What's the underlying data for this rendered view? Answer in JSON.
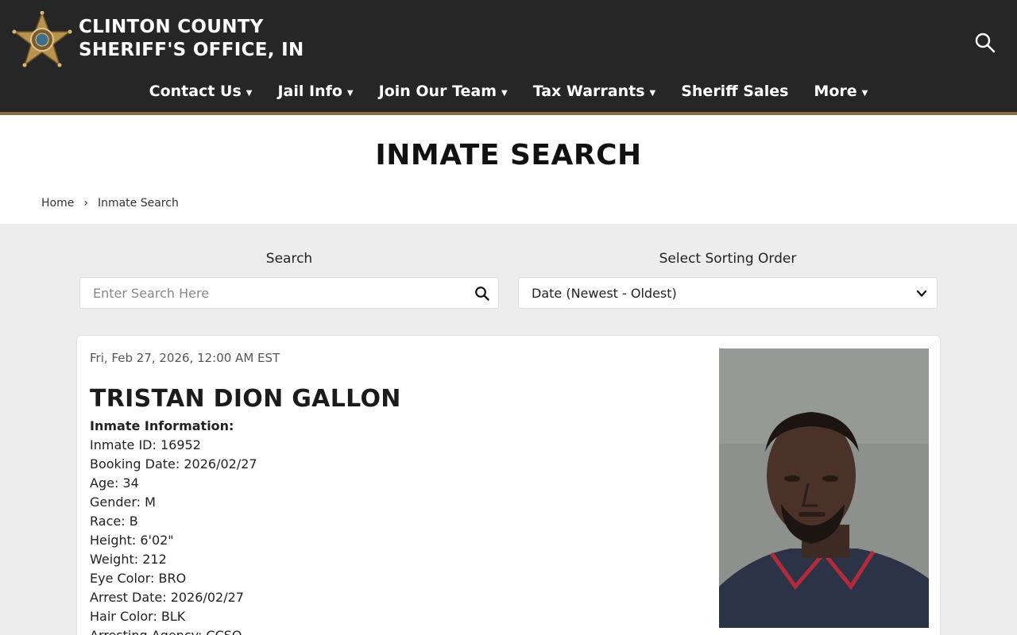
{
  "site": {
    "name_line1": "CLINTON COUNTY",
    "name_line2": "SHERIFF'S OFFICE, IN",
    "logo_icon": "sheriff-star-badge-icon",
    "header_color": "#262626",
    "accent_color": "#8a6a3e"
  },
  "nav": {
    "items": [
      {
        "label": "Contact Us",
        "has_dropdown": true
      },
      {
        "label": "Jail Info",
        "has_dropdown": true
      },
      {
        "label": "Join Our Team",
        "has_dropdown": true
      },
      {
        "label": "Tax Warrants",
        "has_dropdown": true
      },
      {
        "label": "Sheriff Sales",
        "has_dropdown": false
      },
      {
        "label": "More",
        "has_dropdown": true
      }
    ]
  },
  "page": {
    "title": "INMATE SEARCH"
  },
  "breadcrumb": {
    "home": "Home",
    "separator": "›",
    "current": "Inmate Search"
  },
  "search": {
    "label": "Search",
    "placeholder": "Enter Search Here",
    "value": ""
  },
  "sort": {
    "label": "Select Sorting Order",
    "selected": "Date (Newest - Oldest)"
  },
  "inmate": {
    "date": "Fri, Feb 27, 2026, 12:00 AM EST",
    "name": "TRISTAN DION GALLON",
    "info_heading": "Inmate Information:",
    "fields": [
      "Inmate ID: 16952",
      "Booking Date: 2026/02/27",
      "Age: 34",
      "Gender: M",
      "Race: B",
      "Height: 6'02\"",
      "Weight: 212",
      "Eye Color: BRO",
      "Arrest Date: 2026/02/27",
      "Hair Color: BLK",
      "Arresting Agency: CCSO"
    ]
  }
}
